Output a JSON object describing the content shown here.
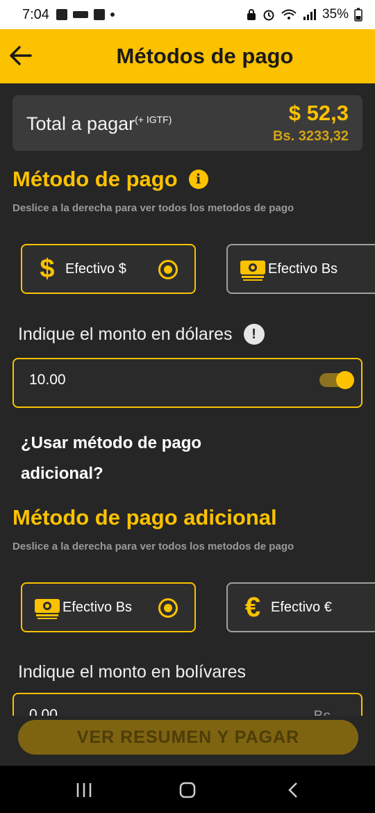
{
  "status_bar": {
    "time": "7:04",
    "battery": "35%"
  },
  "header": {
    "title": "Métodos de pago"
  },
  "total": {
    "label": "Total a pagar",
    "suffix": "(+ IGTF)",
    "usd": "$ 52,3",
    "bs": "Bs. 3233,32"
  },
  "payment_method": {
    "title": "Método de pago",
    "hint": "Deslice a la derecha para ver todos los metodos de pago",
    "options": [
      {
        "label": "Efectivo $",
        "selected": true
      },
      {
        "label": "Efectivo Bs",
        "selected": false
      }
    ]
  },
  "amount_usd": {
    "label": "Indique el monto en  dólares",
    "value": "10.00",
    "currency": "$"
  },
  "additional_toggle": {
    "label": "¿Usar método de pago adicional?",
    "on": true
  },
  "additional_method": {
    "title": "Método de pago adicional",
    "hint": "Deslice a la derecha para ver todos los metodos de pago",
    "options": [
      {
        "label": "Efectivo Bs",
        "selected": true
      },
      {
        "label": "Efectivo €",
        "selected": false
      }
    ]
  },
  "amount_bs": {
    "label": "Indique el monto en  bolívares",
    "value": "0.00",
    "currency": "Bs"
  },
  "pay_button": {
    "label": "VER RESUMEN Y PAGAR"
  },
  "colors": {
    "accent": "#fcc200",
    "background": "#262626"
  }
}
